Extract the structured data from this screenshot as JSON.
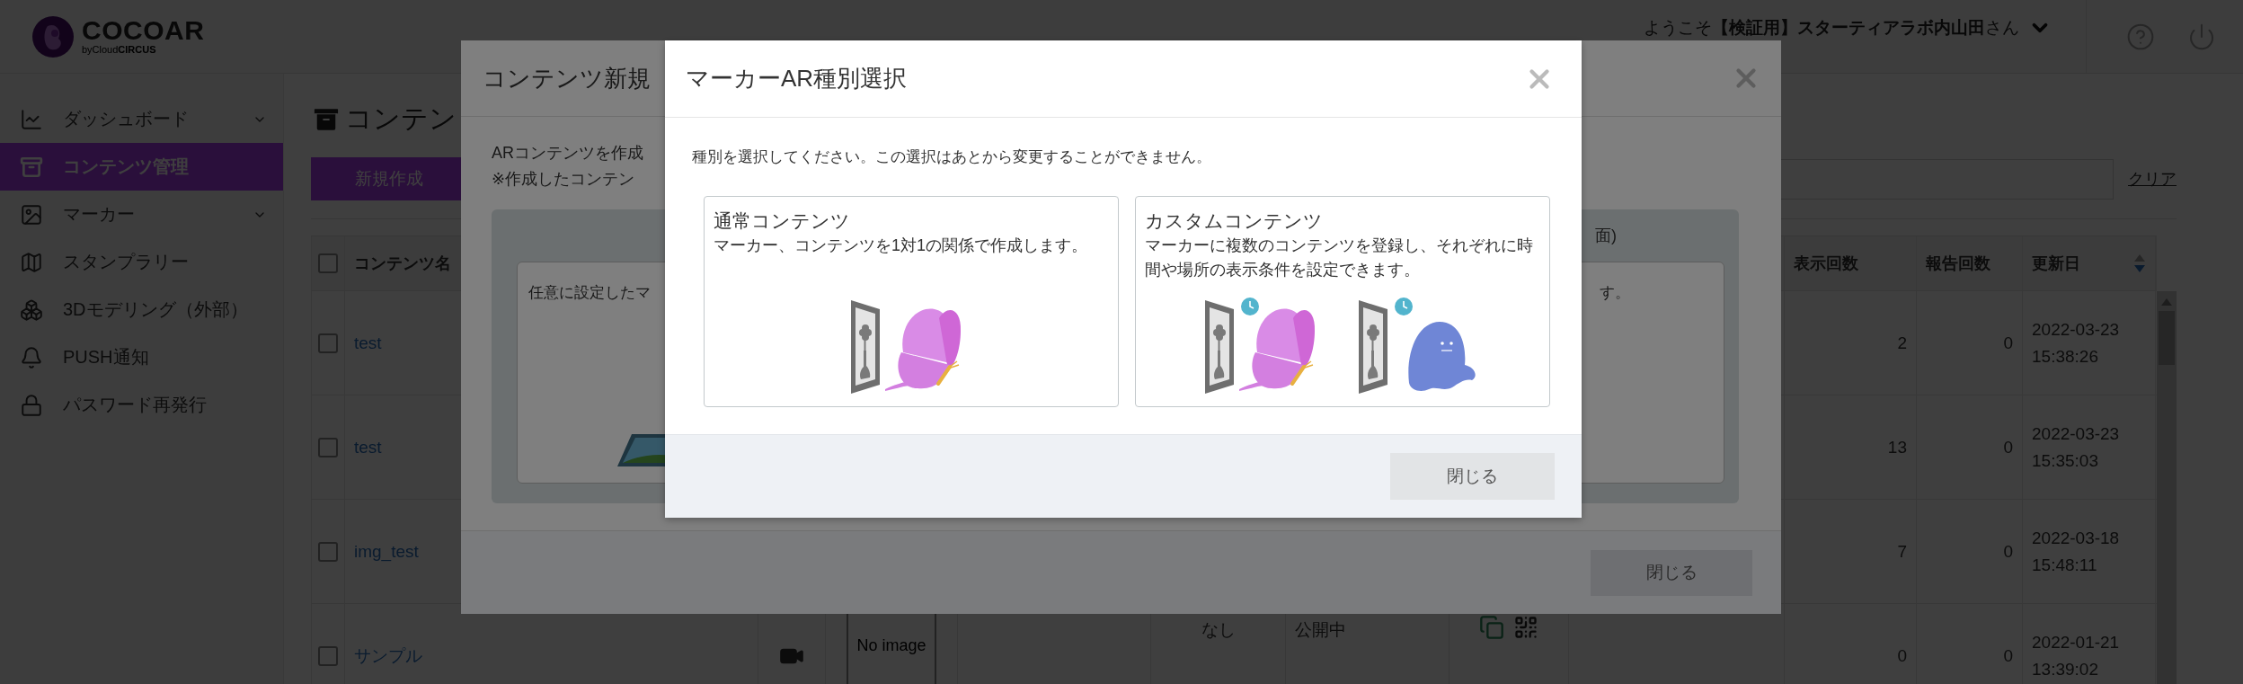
{
  "header": {
    "logo_text": "COCOAR",
    "logo_subtext": "byCloud**CIRCUS**",
    "greeting": "ようこそ**【検証用】スターティアラボ内山田**さん"
  },
  "sidebar": {
    "items": [
      {
        "label": "ダッシュボード",
        "selected": false,
        "expandable": true
      },
      {
        "label": "コンテンツ管理",
        "selected": true,
        "expandable": false
      },
      {
        "label": "マーカー",
        "selected": false,
        "expandable": true
      },
      {
        "label": "スタンプラリー",
        "selected": false,
        "expandable": false
      },
      {
        "label": "3Dモデリング（外部）",
        "selected": false,
        "expandable": false
      },
      {
        "label": "PUSH通知",
        "selected": false,
        "expandable": false
      },
      {
        "label": "パスワード再発行",
        "selected": false,
        "expandable": false
      }
    ]
  },
  "page": {
    "title": "コンテン",
    "new_button": "新規作成",
    "clear_link": "クリア"
  },
  "table": {
    "header_checked": false,
    "columns": [
      {
        "label": "コンテンツ名"
      },
      {
        "label": "表示回数"
      },
      {
        "label": "報告回数"
      },
      {
        "label": "更新日",
        "sort_descending": true
      }
    ],
    "rows": [
      {
        "checked": false,
        "name": "test",
        "views": "2",
        "reports": "0",
        "updated": "2022-03-23 15:38:26"
      },
      {
        "checked": false,
        "name": "test",
        "views": "13",
        "reports": "0",
        "updated": "2022-03-23 15:35:03"
      },
      {
        "checked": false,
        "name": "img_test",
        "views": "7",
        "reports": "0",
        "updated": "2022-03-18 15:48:11"
      },
      {
        "checked": false,
        "name": "サンプル",
        "has_video": true,
        "thumbnail": "No image",
        "marker": "なし",
        "status": "公開中",
        "views": "0",
        "reports": "0",
        "updated": "2022-01-21 13:39:02"
      }
    ]
  },
  "content_modal": {
    "title": "コンテンツ新規",
    "intro_lines": [
      "ARコンテンツを作成",
      "※作成したコンテン"
    ],
    "panel_heading": "面)",
    "left_card_text": "任意に設定したマ",
    "right_card_text": "す。",
    "close_button": "閉じる"
  },
  "type_modal": {
    "title": "マーカーAR種別選択",
    "instruction": "種別を選択してください。この選択はあとから変更することができません。",
    "options": [
      {
        "kind": "single",
        "title": "通常コンテンツ",
        "description": "マーカー、コンテンツを1対1の関係で作成します。"
      },
      {
        "kind": "multiple",
        "title": "カスタムコンテンツ",
        "description": "マーカーに複数のコンテンツを登録し、それぞれに時間や場所の表示条件を設定できます。"
      }
    ],
    "close_button": "閉じる"
  }
}
